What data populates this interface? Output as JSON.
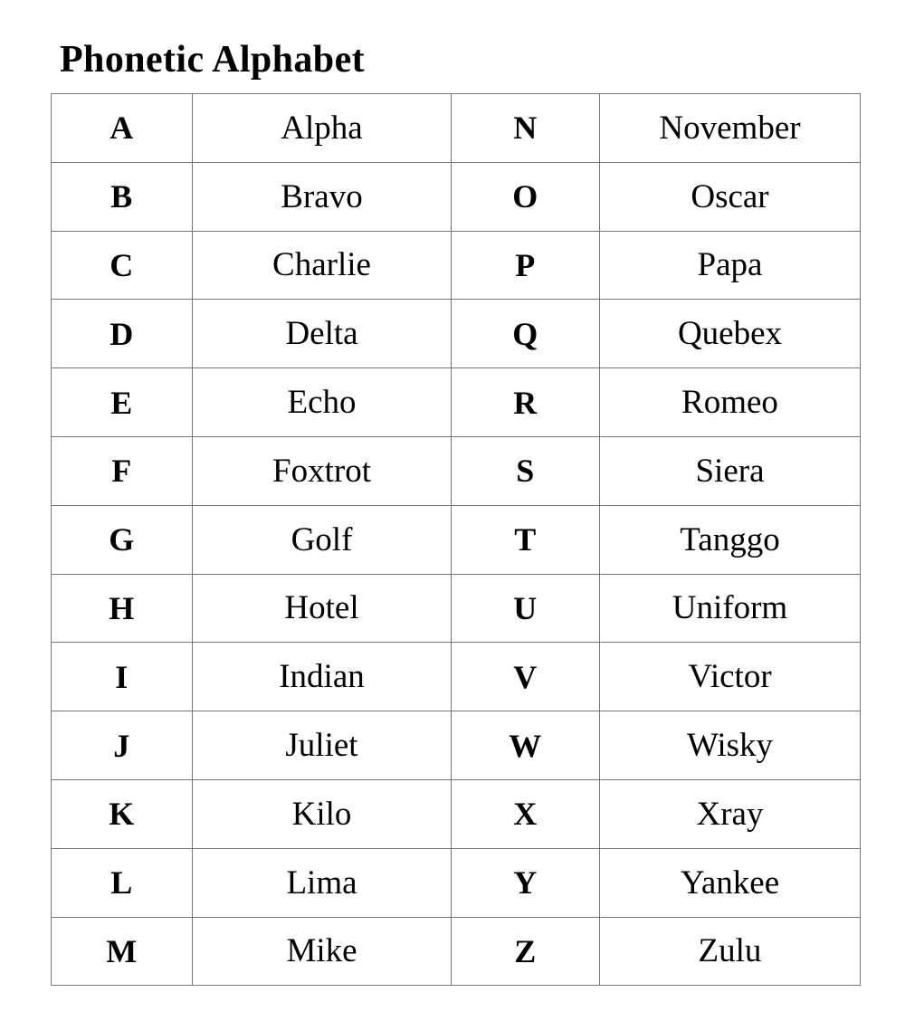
{
  "document": {
    "title": "Phonetic Alphabet"
  },
  "table": {
    "column_count": 4,
    "row_count": 13,
    "rows": [
      {
        "left_letter": "A",
        "left_word": "Alpha",
        "right_letter": "N",
        "right_word": "November"
      },
      {
        "left_letter": "B",
        "left_word": "Bravo",
        "right_letter": "O",
        "right_word": "Oscar"
      },
      {
        "left_letter": "C",
        "left_word": "Charlie",
        "right_letter": "P",
        "right_word": "Papa"
      },
      {
        "left_letter": "D",
        "left_word": "Delta",
        "right_letter": "Q",
        "right_word": "Quebex"
      },
      {
        "left_letter": "E",
        "left_word": "Echo",
        "right_letter": "R",
        "right_word": "Romeo"
      },
      {
        "left_letter": "F",
        "left_word": "Foxtrot",
        "right_letter": "S",
        "right_word": "Siera"
      },
      {
        "left_letter": "G",
        "left_word": "Golf",
        "right_letter": "T",
        "right_word": "Tanggo"
      },
      {
        "left_letter": "H",
        "left_word": "Hotel",
        "right_letter": "U",
        "right_word": "Uniform"
      },
      {
        "left_letter": "I",
        "left_word": "Indian",
        "right_letter": "V",
        "right_word": "Victor"
      },
      {
        "left_letter": "J",
        "left_word": "Juliet",
        "right_letter": "W",
        "right_word": "Wisky"
      },
      {
        "left_letter": "K",
        "left_word": "Kilo",
        "right_letter": "X",
        "right_word": "Xray"
      },
      {
        "left_letter": "L",
        "left_word": "Lima",
        "right_letter": "Y",
        "right_word": "Yankee"
      },
      {
        "left_letter": "M",
        "left_word": "Mike",
        "right_letter": "Z",
        "right_word": "Zulu"
      }
    ]
  },
  "colors": {
    "text": "#000000",
    "border": "#767676",
    "background": "#ffffff"
  }
}
